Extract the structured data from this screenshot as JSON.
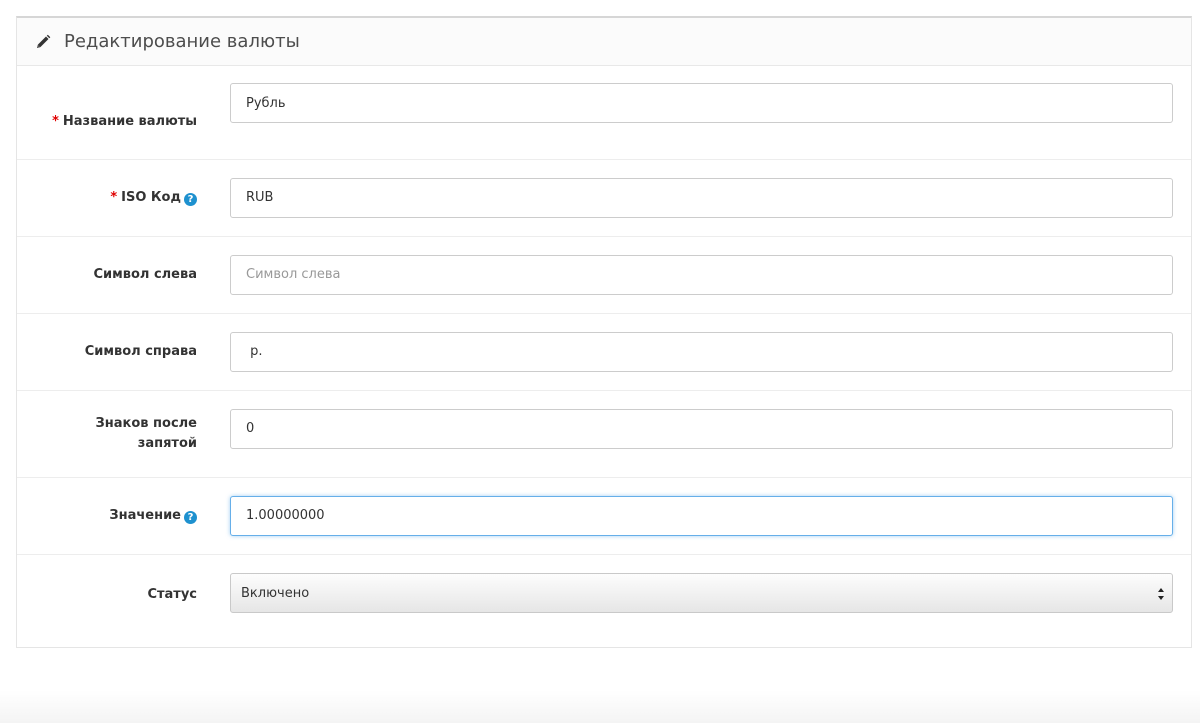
{
  "panel": {
    "title": "Редактирование валюты",
    "icon": "pencil-icon"
  },
  "form": {
    "name": {
      "label": "Название валюты",
      "required": true,
      "value": "Рубль",
      "placeholder": "Название валюты"
    },
    "iso": {
      "label": "ISO Код",
      "required": true,
      "help": "?",
      "value": "RUB",
      "placeholder": "ISO Код"
    },
    "symbol_left": {
      "label": "Символ слева",
      "value": "",
      "placeholder": "Символ слева"
    },
    "symbol_right": {
      "label": "Символ справа",
      "value": " р.",
      "placeholder": "Символ справа"
    },
    "decimal_place": {
      "label_line1": "Знаков после",
      "label_line2": "запятой",
      "value": "0",
      "placeholder": "Знаков после запятой"
    },
    "value": {
      "label": "Значение",
      "help": "?",
      "value": "1.00000000",
      "placeholder": "Значение"
    },
    "status": {
      "label": "Статус",
      "selected": "Включено"
    },
    "required_marker": "*"
  },
  "colors": {
    "required": "#e00000",
    "help": "#1e91cf",
    "focus": "#66afe9"
  }
}
